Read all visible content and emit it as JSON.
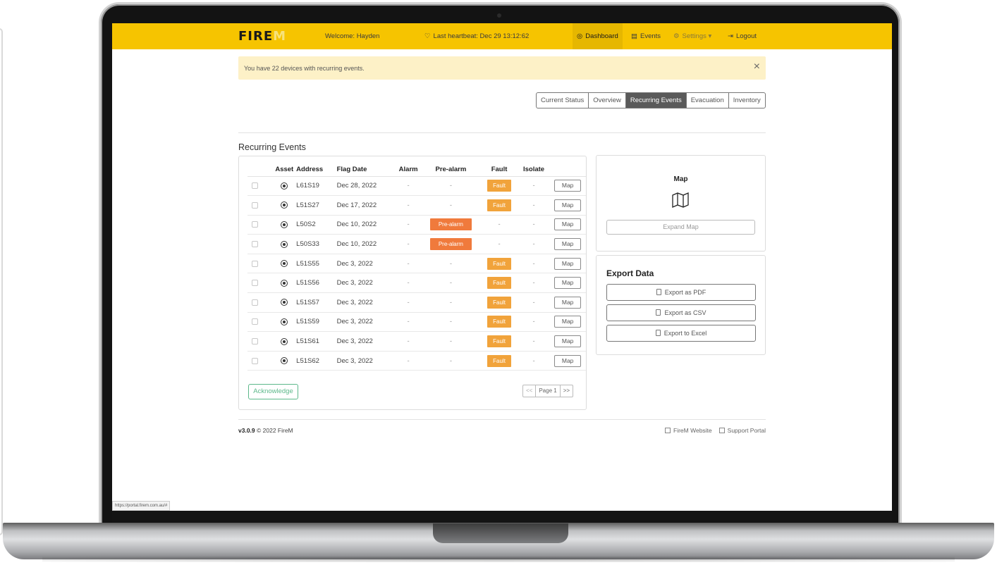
{
  "navbar": {
    "brand": "FIRE",
    "brand_accent": "M",
    "welcome": "Welcome: Hayden",
    "heartbeat": "Last heartbeat: Dec 29 13:12:62",
    "items": [
      {
        "label": "Dashboard",
        "icon": "dashboard-icon"
      },
      {
        "label": "Events",
        "icon": "events-icon"
      },
      {
        "label": "Settings",
        "icon": "gear-icon"
      },
      {
        "label": "Logout",
        "icon": "logout-icon"
      }
    ],
    "accent_color": "#f6c400"
  },
  "alert": {
    "text": "You have 22 devices with recurring events.",
    "close": "×"
  },
  "tabs": [
    "Current Status",
    "Overview",
    "Recurring Events",
    "Evacuation",
    "Inventory"
  ],
  "active_tab": "Recurring Events",
  "section_title": "Recurring Events",
  "table": {
    "headers": [
      "",
      "Asset",
      "Address",
      "Flag Date",
      "Alarm",
      "Pre-alarm",
      "Fault",
      "Isolate",
      ""
    ],
    "rows": [
      {
        "address": "L61S19",
        "date": "Dec 28, 2022",
        "alarm": "-",
        "prealarm": "-",
        "fault": "Fault",
        "isolate": "-",
        "map": "Map"
      },
      {
        "address": "L51S27",
        "date": "Dec 17, 2022",
        "alarm": "-",
        "prealarm": "-",
        "fault": "Fault",
        "isolate": "-",
        "map": "Map"
      },
      {
        "address": "L50S2",
        "date": "Dec 10, 2022",
        "alarm": "-",
        "prealarm": "Pre-alarm",
        "fault": "-",
        "isolate": "-",
        "map": "Map"
      },
      {
        "address": "L50S33",
        "date": "Dec 10, 2022",
        "alarm": "-",
        "prealarm": "Pre-alarm",
        "fault": "-",
        "isolate": "-",
        "map": "Map"
      },
      {
        "address": "L51S55",
        "date": "Dec 3, 2022",
        "alarm": "-",
        "prealarm": "-",
        "fault": "Fault",
        "isolate": "-",
        "map": "Map"
      },
      {
        "address": "L51S56",
        "date": "Dec 3, 2022",
        "alarm": "-",
        "prealarm": "-",
        "fault": "Fault",
        "isolate": "-",
        "map": "Map"
      },
      {
        "address": "L51S57",
        "date": "Dec 3, 2022",
        "alarm": "-",
        "prealarm": "-",
        "fault": "Fault",
        "isolate": "-",
        "map": "Map"
      },
      {
        "address": "L51S59",
        "date": "Dec 3, 2022",
        "alarm": "-",
        "prealarm": "-",
        "fault": "Fault",
        "isolate": "-",
        "map": "Map"
      },
      {
        "address": "L51S61",
        "date": "Dec 3, 2022",
        "alarm": "-",
        "prealarm": "-",
        "fault": "Fault",
        "isolate": "-",
        "map": "Map"
      },
      {
        "address": "L51S62",
        "date": "Dec 3, 2022",
        "alarm": "-",
        "prealarm": "-",
        "fault": "Fault",
        "isolate": "-",
        "map": "Map"
      }
    ],
    "fault_color": "#f1a33b",
    "prealarm_color": "#f07a3c"
  },
  "acknowledge_label": "Acknowledge",
  "pager": {
    "prev": "<<",
    "page": "Page 1",
    "next": ">>"
  },
  "map_panel": {
    "title": "Map",
    "icon": "map-icon",
    "expand_label": "Expand Map"
  },
  "export": {
    "title": "Export Data",
    "buttons": [
      "Export as PDF",
      "Export as CSV",
      "Export to Excel"
    ]
  },
  "footer": {
    "version": "v3.0.9",
    "copyright": "© 2022 FireM",
    "links": [
      "FireM Website",
      "Support Portal"
    ]
  },
  "status_url": "https://portal.firem.com.au/#"
}
